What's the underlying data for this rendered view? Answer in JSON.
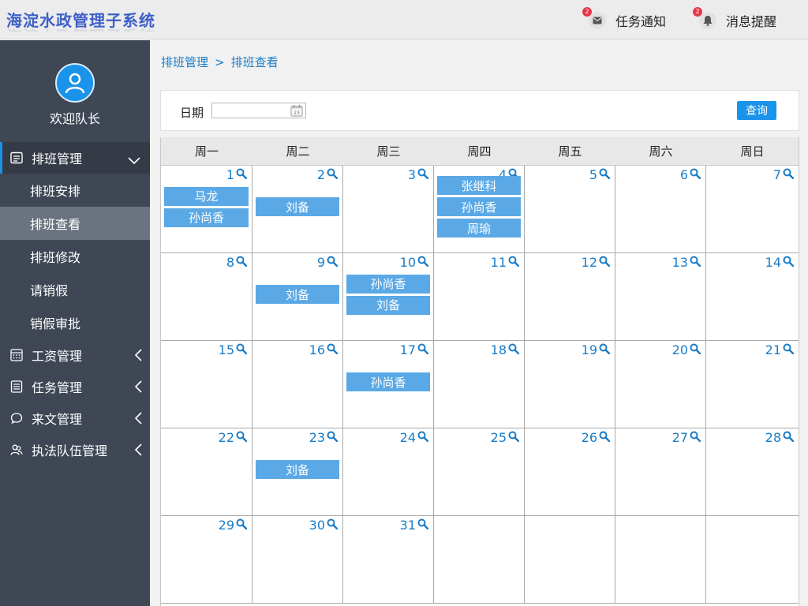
{
  "app": {
    "title": "海淀水政管理子系统"
  },
  "header": {
    "task": {
      "label": "任务通知",
      "badge": "2",
      "icon": "mail-icon"
    },
    "message": {
      "label": "消息提醒",
      "badge": "2",
      "icon": "bell-icon"
    }
  },
  "sidebar": {
    "welcome": "欢迎队长",
    "menu": [
      {
        "label": "排班管理",
        "icon": "list-icon",
        "open": true,
        "children": [
          {
            "label": "排班安排"
          },
          {
            "label": "排班查看",
            "active": true
          },
          {
            "label": "排班修改"
          },
          {
            "label": "请销假"
          },
          {
            "label": "销假审批"
          }
        ]
      },
      {
        "label": "工资管理",
        "icon": "calculator-icon"
      },
      {
        "label": "任务管理",
        "icon": "document-icon"
      },
      {
        "label": "来文管理",
        "icon": "chat-icon"
      },
      {
        "label": "执法队伍管理",
        "icon": "users-icon"
      }
    ]
  },
  "breadcrumb": {
    "parent": "排班管理",
    "separator": ">",
    "current": "排班查看"
  },
  "filter": {
    "date_label": "日期",
    "date_value": "",
    "calendar_day": "23",
    "query_label": "查询"
  },
  "calendar": {
    "weekdays": [
      "周一",
      "周二",
      "周三",
      "周四",
      "周五",
      "周六",
      "周日"
    ],
    "days": [
      {
        "day": "1",
        "duties": [
          "马龙",
          "孙尚香"
        ]
      },
      {
        "day": "2",
        "duties": [
          "刘备"
        ]
      },
      {
        "day": "3",
        "duties": []
      },
      {
        "day": "4",
        "duties": [
          "张继科",
          "孙尚香",
          "周瑜"
        ]
      },
      {
        "day": "5",
        "duties": []
      },
      {
        "day": "6",
        "duties": []
      },
      {
        "day": "7",
        "duties": []
      },
      {
        "day": "8",
        "duties": []
      },
      {
        "day": "9",
        "duties": [
          "刘备"
        ]
      },
      {
        "day": "10",
        "duties": [
          "孙尚香",
          "刘备"
        ]
      },
      {
        "day": "11",
        "duties": []
      },
      {
        "day": "12",
        "duties": []
      },
      {
        "day": "13",
        "duties": []
      },
      {
        "day": "14",
        "duties": []
      },
      {
        "day": "15",
        "duties": []
      },
      {
        "day": "16",
        "duties": []
      },
      {
        "day": "17",
        "duties": [
          "孙尚香"
        ]
      },
      {
        "day": "18",
        "duties": []
      },
      {
        "day": "19",
        "duties": []
      },
      {
        "day": "20",
        "duties": []
      },
      {
        "day": "21",
        "duties": []
      },
      {
        "day": "22",
        "duties": []
      },
      {
        "day": "23",
        "duties": [
          "刘备"
        ]
      },
      {
        "day": "24",
        "duties": []
      },
      {
        "day": "25",
        "duties": []
      },
      {
        "day": "26",
        "duties": []
      },
      {
        "day": "27",
        "duties": []
      },
      {
        "day": "28",
        "duties": []
      },
      {
        "day": "29",
        "duties": []
      },
      {
        "day": "30",
        "duties": []
      },
      {
        "day": "31",
        "duties": []
      },
      {
        "day": "",
        "duties": []
      },
      {
        "day": "",
        "duties": []
      },
      {
        "day": "",
        "duties": []
      },
      {
        "day": "",
        "duties": []
      }
    ]
  },
  "colors": {
    "accent": "#1a93ea",
    "sidebar": "#3f4654",
    "duty": "#5aa9e6",
    "link": "#1a7cc7"
  }
}
